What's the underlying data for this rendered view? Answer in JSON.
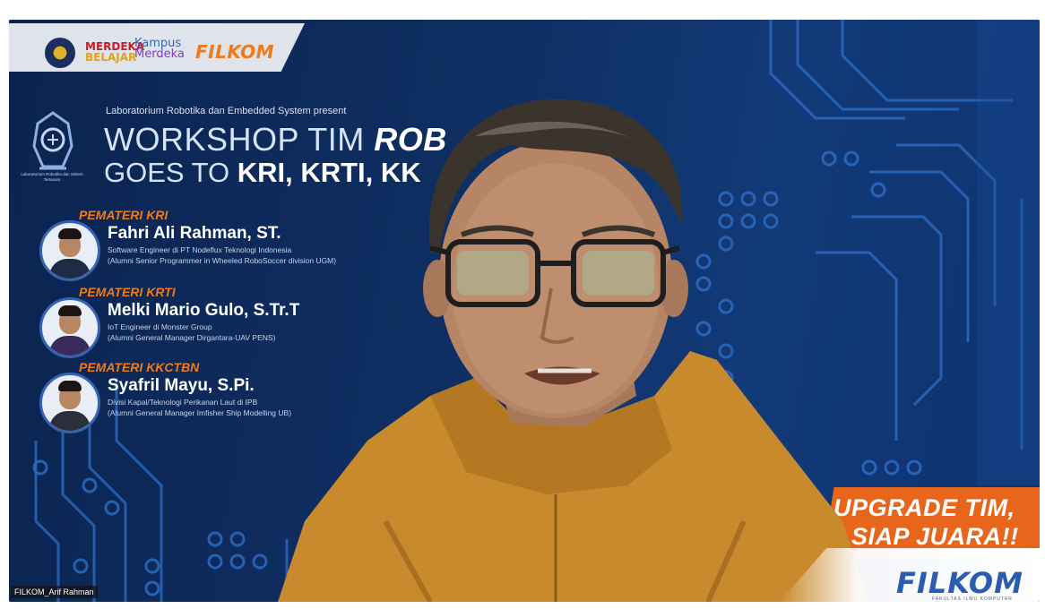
{
  "slide": {
    "logos": {
      "merdeka_line1": "MERDEKA",
      "merdeka_line2": "BELAJAR",
      "kampus_line1": "Kampus",
      "kampus_line2": "Merdeka",
      "filkom": "FILKOM"
    },
    "lab_logo_text": "Laboratorium Robotika dan Sistem Tertanam",
    "present_line": "Laboratorium Robotika dan Embedded System present",
    "title_line1_prefix": "WORKSHOP TIM ",
    "title_line1_bold": "ROB",
    "title_line2_prefix": "GOES TO ",
    "title_line2_bold": "KRI, KRTI, KK",
    "speakers": [
      {
        "role": "PEMATERI KRI",
        "name": "Fahri Ali Rahman, ST.",
        "line1": "Software Engineer di PT Nodeflux Teknologi Indonesia",
        "line2": "(Alumni Senior Programmer in Wheeled RoboSoccer division UGM)"
      },
      {
        "role": "PEMATERI KRTI",
        "name": "Melki Mario Gulo, S.Tr.T",
        "line1": "IoT Engineer di Monster Group",
        "line2": "(Alumni General Manager Dirgantara-UAV PENS)"
      },
      {
        "role": "PEMATERI KKCTBN",
        "name": "Syafril Mayu, S.Pi.",
        "line1": "Divisi Kapal/Teknologi Perikanan Laut di IPB",
        "line2": "(Alumni General Manager Imfisher Ship Modelling UB)"
      }
    ],
    "banner_line1": "UPGRADE TIM,",
    "banner_line2": "SIAP JUARA!!",
    "corner_logo": "FILKOM",
    "corner_sub": "FAKULTAS ILMU KOMPUTER"
  },
  "participant_name": "FILKOM_Arif Rahman",
  "colors": {
    "slide_bg": "#0f2f63",
    "accent_orange": "#e8661c",
    "hoodie": "#c98a2e"
  }
}
